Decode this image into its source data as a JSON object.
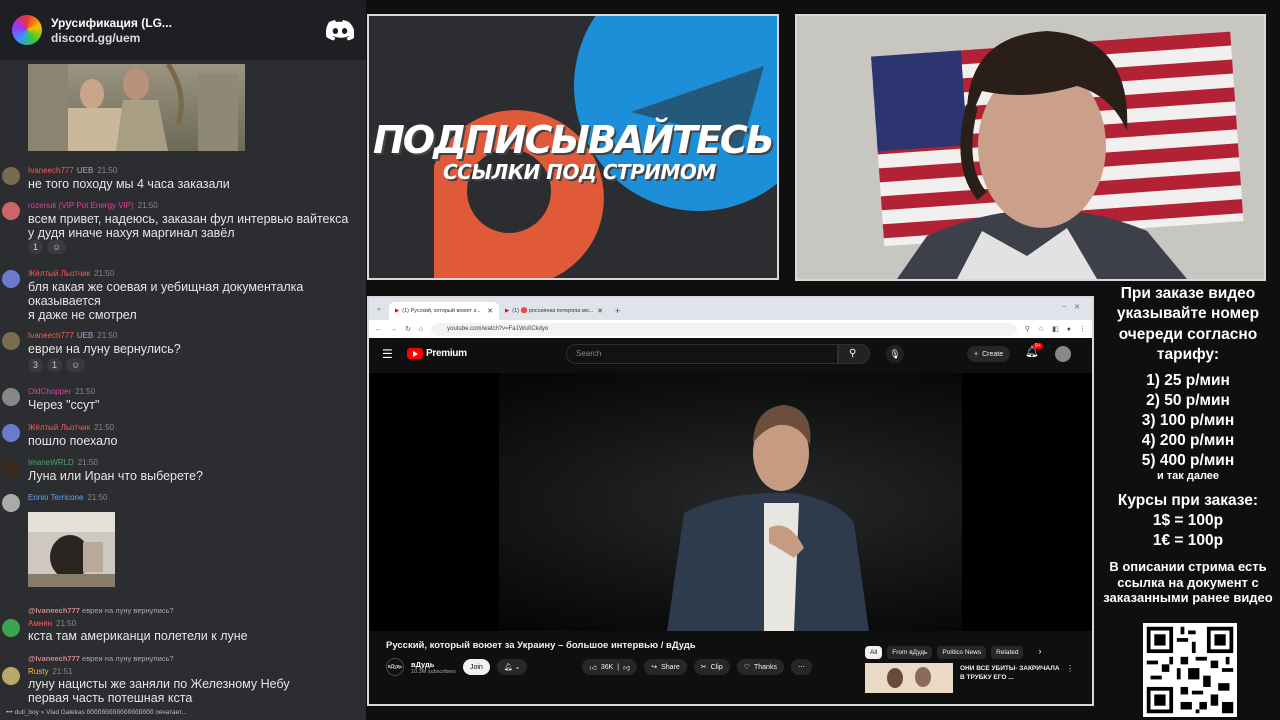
{
  "discord": {
    "server_name": "Урусификация (LG...",
    "invite": "discord.gg/uem",
    "typing_text": "dull_boy » Vlad Galekas бббббббббббббббббб печатает..."
  },
  "chat": [
    {
      "author": "Ivaneech777",
      "badge": "UEB",
      "time": "21:50",
      "color": "#ff5a4e",
      "text": "не того походу мы 4 часа заказали"
    },
    {
      "author": "rozenuk (VIP Pot Energy VIP)",
      "badge": "",
      "time": "21:50",
      "color": "#e040a0",
      "text": "всем привет, надеюсь, заказан фул интервью вайтекса у дудя иначе нахуя маргинал завёл",
      "reactions": [
        "1"
      ]
    },
    {
      "author": "Жёлтый Льотчик",
      "badge": "",
      "time": "21:50",
      "color": "#ff5a4e",
      "text": "бля какая же соевая и уебищная документалка оказывается\nя даже не смотрел"
    },
    {
      "author": "Ivaneech777",
      "badge": "UEB",
      "time": "21:50",
      "color": "#ff5a4e",
      "text": "евреи на луну вернулись?",
      "reactions": [
        "3",
        "1"
      ]
    },
    {
      "author": "OldChopper",
      "badge": "",
      "time": "21:50",
      "color": "#e040a0",
      "text": "Через \"ссут\""
    },
    {
      "author": "Жёлтый Льотчик",
      "badge": "",
      "time": "21:50",
      "color": "#ff5a4e",
      "text": "пошло поехало"
    },
    {
      "author": "ImaneWRLD",
      "badge": "",
      "time": "21:50",
      "color": "#4ea36c",
      "text": "Луна или Иран что выберете?"
    },
    {
      "author": "Ennio Terricone",
      "badge": "",
      "time": "21:50",
      "color": "#5aa8ff",
      "text": ""
    },
    {
      "author": "Амнян",
      "badge": "",
      "time": "21:50",
      "color": "#ff5a4e",
      "reply_author": "@Ivaneech777",
      "reply_text": "евреи на луну вернулись?",
      "text": "кста там американци полетели к луне"
    },
    {
      "author": "Rusty",
      "badge": "",
      "time": "21:51",
      "color": "#ffb84a",
      "reply_author": "@Ivaneech777",
      "reply_text": "евреи на луну вернулись?",
      "text": "луну нацисты же заняли по Железному Небу\nпервая часть потешная кста"
    }
  ],
  "promo": {
    "title": "ПОДПИСЫВАЙТЕСЬ",
    "subtitle": "ССЫЛКИ ПОД СТРИМОМ"
  },
  "browser": {
    "tab1": "(1) Русский, который воюет з...",
    "tab2": "(1) 🔴 россиянка потеряла мо...",
    "url": "youtube.com/watch?v=Fa1Wu0Ckdyo"
  },
  "youtube": {
    "logo_text": "Premium",
    "search_placeholder": "Search",
    "create_label": "Create",
    "notif_count": "9+",
    "title": "Русский, который воюет за Украину – большое интервью / вДудь",
    "channel": "вДудь",
    "subscribers": "10.3M subscribers",
    "join": "Join",
    "likes": "36K",
    "share": "Share",
    "clip": "Clip",
    "thanks": "Thanks",
    "chips": [
      "All",
      "From вДудь",
      "Politics News",
      "Related"
    ],
    "side_video_title": "ОНИ ВСЕ УБИТЫ- ЗАКРИЧАЛА В ТРУБКУ ЕГО ..."
  },
  "info": {
    "intro": "При заказе видео указывайте номер очереди согласно тарифу:",
    "tariffs": [
      "1) 25 р/мин",
      "2) 50 р/мин",
      "3) 100 р/мин",
      "4) 200 р/мин",
      "5) 400 р/мин"
    ],
    "etc": "и так далее",
    "rates_title": "Курсы при заказе:",
    "rates": [
      "1$ = 100р",
      "1€ = 100р"
    ],
    "doc_note": "В описании стрима есть ссылка на документ с заказанными ранее видео"
  },
  "colors": {
    "youtube_red": "#ff0000",
    "discord_bg": "#2b2d31",
    "accent_blue": "#1d8fd8",
    "accent_orange": "#e05a3a"
  }
}
